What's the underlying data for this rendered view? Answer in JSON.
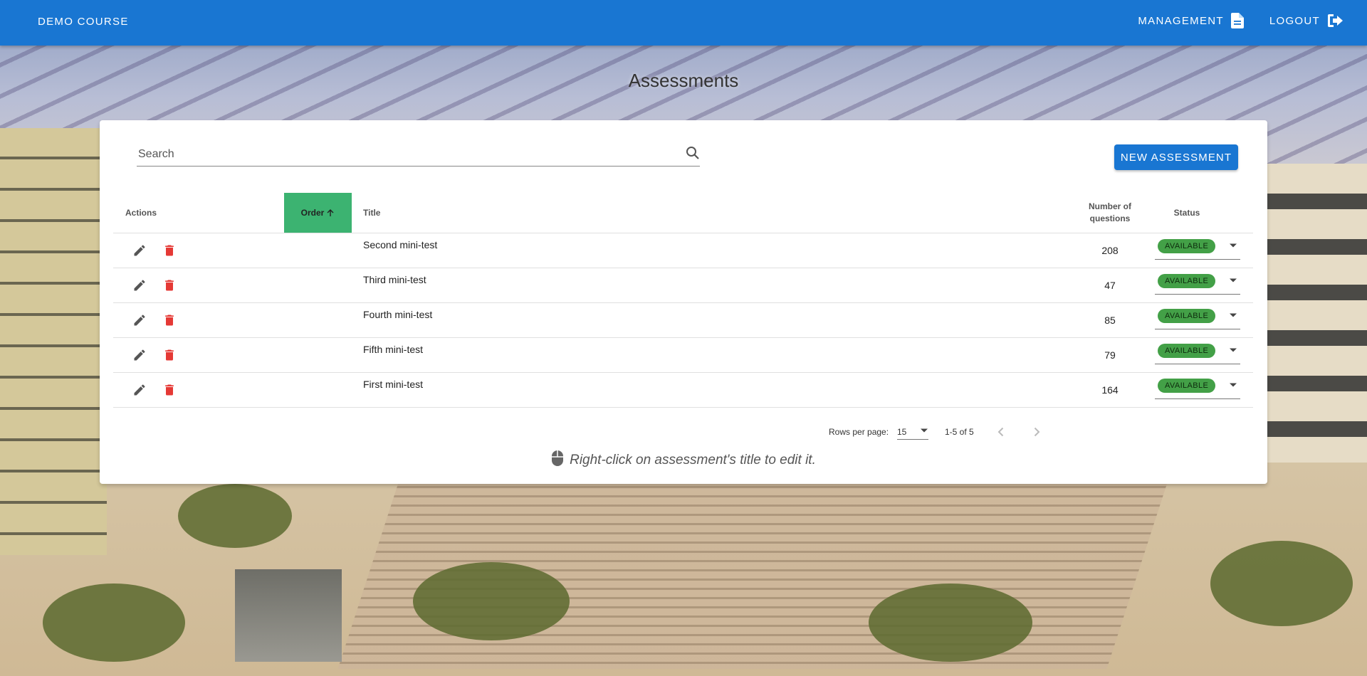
{
  "appbar": {
    "course": "DEMO COURSE",
    "management": "MANAGEMENT",
    "logout": "LOGOUT"
  },
  "page": {
    "title": "Assessments"
  },
  "search": {
    "placeholder": "Search"
  },
  "new_button": "NEW ASSESSMENT",
  "table": {
    "headers": {
      "actions": "Actions",
      "order": "Order",
      "title": "Title",
      "count_line1": "Number of",
      "count_line2": "questions",
      "status": "Status"
    },
    "rows": [
      {
        "title": "Second mini-test",
        "questions": "208",
        "status": "AVAILABLE"
      },
      {
        "title": "Third mini-test",
        "questions": "47",
        "status": "AVAILABLE"
      },
      {
        "title": "Fourth mini-test",
        "questions": "85",
        "status": "AVAILABLE"
      },
      {
        "title": "Fifth mini-test",
        "questions": "79",
        "status": "AVAILABLE"
      },
      {
        "title": "First mini-test",
        "questions": "164",
        "status": "AVAILABLE"
      }
    ]
  },
  "pagination": {
    "rows_per_page_label": "Rows per page:",
    "rows_per_page": "15",
    "range": "1-5 of 5"
  },
  "hint": "Right-click on assessment's title to edit it.",
  "colors": {
    "primary": "#1976d2",
    "order_header": "#3cb371",
    "status_chip": "#43a047",
    "delete": "#e53935"
  }
}
